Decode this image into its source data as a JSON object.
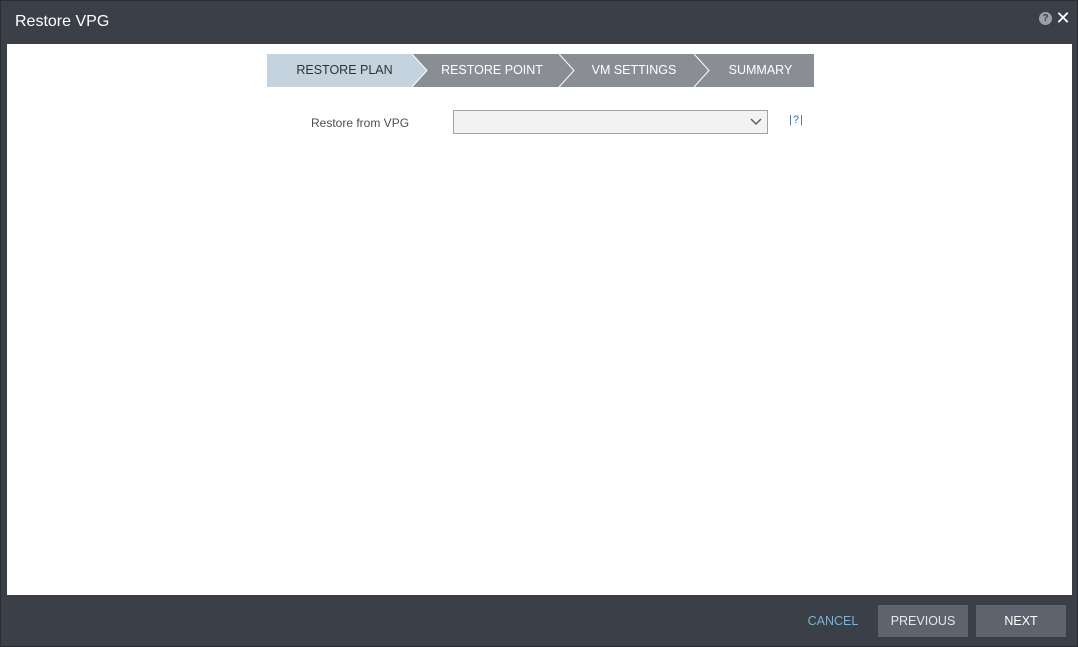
{
  "window": {
    "title": "Restore VPG",
    "help_icon_glyph": "?",
    "close_icon_glyph": "✕"
  },
  "wizard": {
    "steps": [
      {
        "label": "RESTORE PLAN",
        "active": true
      },
      {
        "label": "RESTORE POINT",
        "active": false
      },
      {
        "label": "VM SETTINGS",
        "active": false
      },
      {
        "label": "SUMMARY",
        "active": false
      }
    ]
  },
  "form": {
    "restore_from_vpg": {
      "label": "Restore from VPG",
      "value": "",
      "help_text": "|?|"
    }
  },
  "footer": {
    "cancel_label": "CANCEL",
    "previous_label": "PREVIOUS",
    "next_label": "NEXT"
  },
  "colors": {
    "chrome": "#3b4048",
    "step_active": "#c5d3df",
    "step_inactive": "#8a8e94",
    "button": "#5e646d",
    "cancel_text": "#7fb3d0",
    "help_link": "#2f6fb8"
  }
}
